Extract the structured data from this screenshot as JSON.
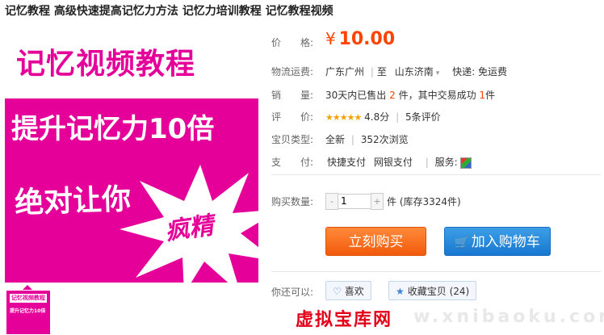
{
  "title": "记忆教程 高级快速提高记忆力方法 记忆力培训教程 记忆教程视频",
  "main_image": {
    "line1": "记忆视频教程",
    "line2": "提升记忆力10倍",
    "line3": "绝对让你",
    "line4": "疯精"
  },
  "thumbnail": {
    "line1": "记忆视频教程",
    "line2": "提升记忆力10倍"
  },
  "price": {
    "label": "价　　格:",
    "currency": "¥",
    "value": "10.00"
  },
  "shipping": {
    "label": "物流运费:",
    "from": "广东广州",
    "to_word": "至",
    "to": "山东济南",
    "express": "快递: 免运费"
  },
  "sales": {
    "label": "销　　量:",
    "prefix": "30天内已售出",
    "sold": "2",
    "mid": "件，其中交易成功",
    "success": "1",
    "suffix": "件"
  },
  "rating": {
    "label": "评　　价:",
    "stars": "★★★★★",
    "score": "4.8分",
    "reviews": "5条评价"
  },
  "item_type": {
    "label": "宝贝类型:",
    "condition": "全新",
    "views": "352次浏览"
  },
  "payment": {
    "label": "支　　付:",
    "methods": [
      "快捷支付",
      "网银支付"
    ],
    "service_label": "服务:"
  },
  "quantity": {
    "label": "购买数量:",
    "minus": "-",
    "value": "1",
    "plus": "+",
    "stock": "件 (库存3324件)"
  },
  "buttons": {
    "buy": "立刻购买",
    "cart": "加入购物车"
  },
  "extras": {
    "label": "你还可以:",
    "like": "喜欢",
    "favorite": "收藏宝贝 (24)"
  },
  "watermark": "虚拟宝库网",
  "watermark_faint": "w.xnibaoku.com",
  "colors": {
    "accent": "#ff4400",
    "magenta": "#e6009a",
    "blue": "#1878d1"
  }
}
